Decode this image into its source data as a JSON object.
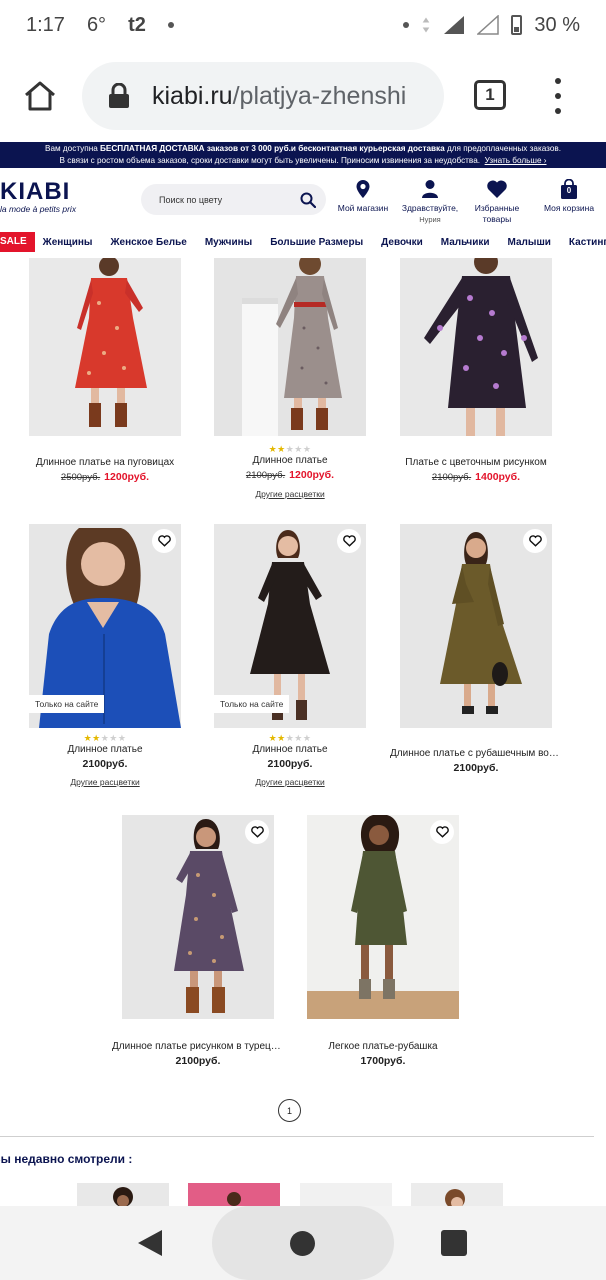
{
  "status_bar": {
    "time": "1:17",
    "temp": "6°",
    "carrier": "t2",
    "battery": "30 %"
  },
  "browser": {
    "url_host": "kiabi.ru",
    "url_path": "/platjya-zhenshi",
    "tab_count": "1"
  },
  "promo": {
    "line1_pre": "Вам доступна ",
    "line1_bold": "БЕСПЛАТНАЯ ДОСТАВКА заказов от 3 000 руб.и бесконтактная курьерская доставка",
    "line1_post": " для предоплаченных заказов.",
    "line2": "В связи с ростом объема заказов, сроки доставки могут быть увеличены. Приносим извинения за неудобства.",
    "line2_link": "Узнать больше ›"
  },
  "header": {
    "logo": "KIABI",
    "tagline": "la mode à petits prix",
    "search_placeholder": "Поиск по цвету",
    "store_label": "Мой магазин",
    "account_label": "Здравствуйте,",
    "account_name": "Нурия",
    "wishlist_label": "Избранные товары",
    "cart_label": "Моя корзина",
    "cart_count": "0"
  },
  "nav": {
    "sale": "SALE",
    "categories": [
      "Женщины",
      "Женское Белье",
      "Мужчины",
      "Большие Размеры",
      "Девочки",
      "Мальчики",
      "Малыши",
      "Кастинги"
    ]
  },
  "products": [
    {
      "name": "Длинное платье на пуговицах",
      "old_price": "2500руб.",
      "price": "1200руб.",
      "stars": 0,
      "badge": "",
      "colors": ""
    },
    {
      "name": "Длинное платье",
      "old_price": "2100руб.",
      "price": "1200руб.",
      "stars": 2,
      "badge": "",
      "colors": "Другие расцветки"
    },
    {
      "name": "Платье с цветочным рисунком",
      "old_price": "2100руб.",
      "price": "1400руб.",
      "stars": 0,
      "badge": "",
      "colors": ""
    },
    {
      "name": "Длинное платье",
      "old_price": "",
      "price": "2100руб.",
      "stars": 2,
      "badge": "Только на сайте",
      "colors": "Другие расцветки"
    },
    {
      "name": "Длинное платье",
      "old_price": "",
      "price": "2100руб.",
      "stars": 2,
      "badge": "Только на сайте",
      "colors": "Другие расцветки"
    },
    {
      "name": "Длинное платье с рубашечным воротником",
      "old_price": "",
      "price": "2100руб.",
      "stars": 0,
      "badge": "",
      "colors": ""
    },
    {
      "name": "Длинное платье рисунком в турецкий огурец",
      "old_price": "",
      "price": "2100руб.",
      "stars": 0,
      "badge": "",
      "colors": ""
    },
    {
      "name": "Легкое платье-рубашка",
      "old_price": "",
      "price": "1700руб.",
      "stars": 0,
      "badge": "",
      "colors": ""
    }
  ],
  "pagination": {
    "current": "1"
  },
  "recent": {
    "title": "Вы недавно смотрели :"
  }
}
